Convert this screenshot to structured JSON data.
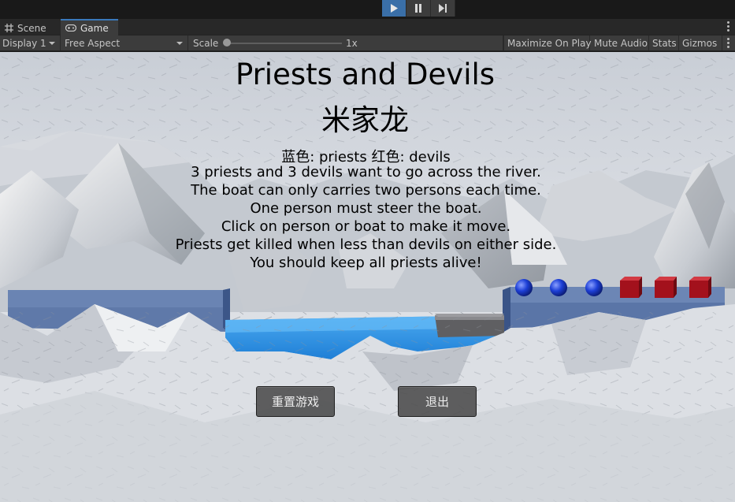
{
  "toolbar": {
    "play_icon": "play-icon",
    "pause_icon": "pause-icon",
    "step_icon": "step-icon",
    "accent_color": "#3a6fa8"
  },
  "tabs": [
    {
      "label": "Scene",
      "icon": "grid-icon"
    },
    {
      "label": "Game",
      "icon": "gamepad-icon"
    }
  ],
  "game_toolbar": {
    "display": "Display 1",
    "aspect": "Free Aspect",
    "scale_label": "Scale",
    "scale_value": "1x",
    "maximize": "Maximize On Play",
    "mute": "Mute Audio",
    "stats": "Stats",
    "gizmos": "Gizmos"
  },
  "game": {
    "title": "Priests and Devils",
    "author": "米家龙",
    "legend": "蓝色: priests     红色: devils",
    "lines": [
      "3 priests and 3 devils want to go across the river.",
      "The boat can only carries two persons each time.",
      "One person must steer the boat.",
      "Click on person or boat to make it move.",
      "Priests get killed when less than devils on either side.",
      "You should keep all priests alive!"
    ],
    "reset_button": "重置游戏",
    "quit_button": "退出",
    "priest_color": "#1d3fd6",
    "devil_color": "#b3121f",
    "water_color": "#2a8fe8",
    "bank_color": "#5d78a8"
  }
}
